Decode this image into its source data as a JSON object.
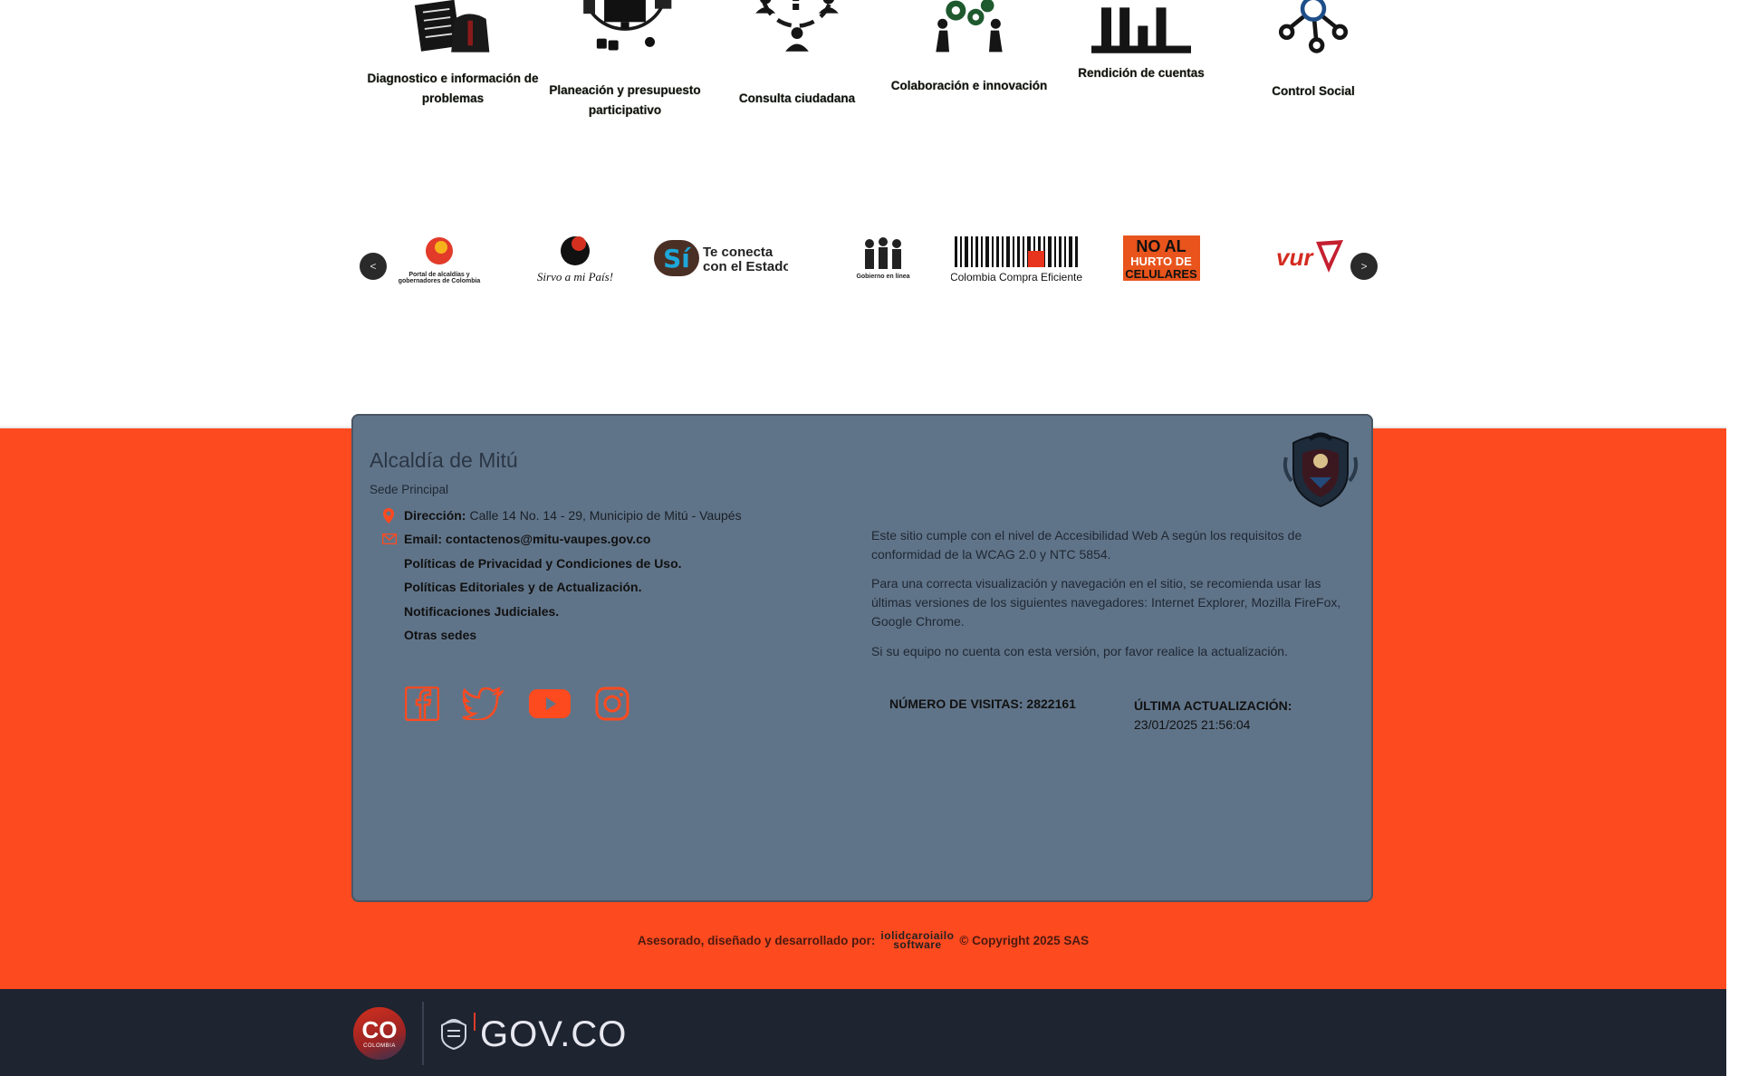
{
  "participation": {
    "items": [
      {
        "label": "Diagnostico e información de problemas",
        "icon": "document-person-icon"
      },
      {
        "label": "Planeación y presupuesto participativo",
        "icon": "computer-network-icon"
      },
      {
        "label": "Consulta ciudadana",
        "icon": "question-people-icon"
      },
      {
        "label": "Colaboración e innovación",
        "icon": "gears-people-icon"
      },
      {
        "label": "Rendición de cuentas",
        "icon": "bar-chart-icon"
      },
      {
        "label": "Control Social",
        "icon": "network-nodes-icon"
      }
    ]
  },
  "carousel": {
    "prev_label": "<",
    "next_label": ">",
    "logos": [
      {
        "text": "Portal de alcaldías y gobernadores de Colombia",
        "icon": "portal-alcaldias-logo"
      },
      {
        "text": "Sirvo a mi País!",
        "icon": "sirvo-a-mi-pais-logo"
      },
      {
        "text": "Te conecta con el Estado",
        "icon": "si-virtual-logo"
      },
      {
        "text": "Gobierno en línea",
        "icon": "gobierno-en-linea-logo"
      },
      {
        "text": "Colombia Compra Eficiente",
        "icon": "colombia-compra-logo"
      },
      {
        "text": "NO AL HURTO DE CELULARES",
        "icon": "no-al-hurto-logo"
      },
      {
        "text": "vur",
        "icon": "vur-logo"
      }
    ]
  },
  "footer": {
    "title": "Alcaldía de Mitú",
    "subtitle": "Sede Principal",
    "address_label": "Dirección:",
    "address_value": "Calle 14 No. 14 - 29, Municipio de Mitú - Vaupés",
    "email_label": "Email: contactenos@mitu-vaupes.gov.co",
    "links": [
      "Políticas de Privacidad y Condiciones de Uso.",
      "Políticas Editoriales y de Actualización.",
      "Notificaciones Judiciales.",
      "Otras sedes"
    ],
    "accessibility_text": "Este sitio cumple con el nivel de Accesibilidad Web A según los requisitos de conformidad de la WCAG 2.0 y NTC 5854.",
    "browsers_text": "Para una correcta visualización y navegación en el sitio, se recomienda usar las últimas versiones de los siguientes navegadores: Internet Explorer, Mozilla FireFox, Google Chrome.",
    "update_text": "Si su equipo no cuenta con esta versión, por favor realice la actualización.",
    "visits_label": "NÚMERO DE VISITAS:",
    "visits_value": "2822161",
    "last_update_label": "ÚLTIMA ACTUALIZACIÓN:",
    "last_update_value": "23/01/2025 21:56:04",
    "social": [
      "facebook-icon",
      "twitter-icon",
      "youtube-icon",
      "instagram-icon"
    ]
  },
  "credit": {
    "prefix": "Asesorado, diseñado y desarrollado por:",
    "logo_text_top": "iolidcaroiailo",
    "logo_text_bottom": "software",
    "suffix": "© Copyright 2025 SAS"
  },
  "gov_bar": {
    "co_text": "CO",
    "co_sub": "COLOMBIA",
    "gov_text": "GOV.CO"
  },
  "colors": {
    "accent": "#fe4a1f",
    "card": "#607489",
    "bar": "#1e2430"
  }
}
